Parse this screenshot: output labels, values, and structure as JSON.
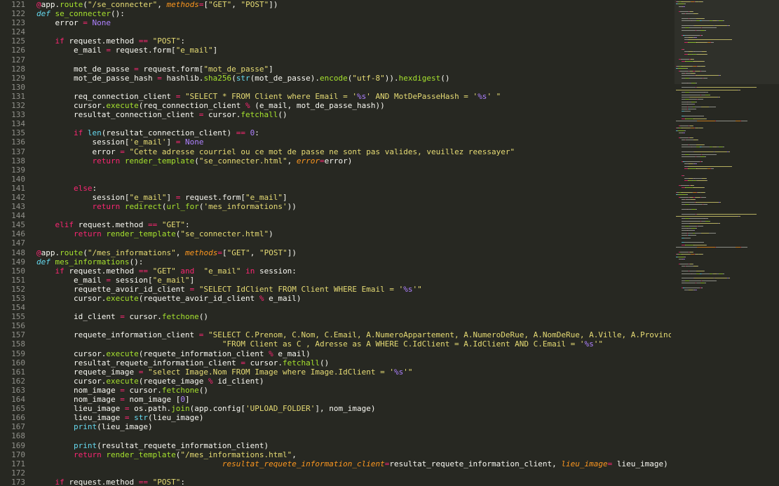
{
  "lines": [
    {
      "n": "121",
      "indent": 0,
      "tokens": [
        [
          "dec",
          "@"
        ],
        [
          "p",
          "app."
        ],
        [
          "fn",
          "route"
        ],
        [
          "p",
          "("
        ],
        [
          "str",
          "\"/se_connecter\""
        ],
        [
          "p",
          ", "
        ],
        [
          "param",
          "methods"
        ],
        [
          "op",
          "="
        ],
        [
          "p",
          "["
        ],
        [
          "str",
          "\"GET\""
        ],
        [
          "p",
          ", "
        ],
        [
          "str",
          "\"POST\""
        ],
        [
          "p",
          "])"
        ]
      ]
    },
    {
      "n": "122",
      "indent": 0,
      "tokens": [
        [
          "def",
          "def"
        ],
        [
          "p",
          " "
        ],
        [
          "fn",
          "se_connecter"
        ],
        [
          "p",
          "():"
        ]
      ]
    },
    {
      "n": "123",
      "indent": 1,
      "tokens": [
        [
          "p",
          "error "
        ],
        [
          "op",
          "="
        ],
        [
          "p",
          " "
        ],
        [
          "const",
          "None"
        ]
      ]
    },
    {
      "n": "124",
      "indent": 0,
      "tokens": []
    },
    {
      "n": "125",
      "indent": 1,
      "tokens": [
        [
          "kw",
          "if"
        ],
        [
          "p",
          " request.method "
        ],
        [
          "op",
          "=="
        ],
        [
          "p",
          " "
        ],
        [
          "str",
          "\"POST\""
        ],
        [
          "p",
          ":"
        ]
      ]
    },
    {
      "n": "126",
      "indent": 2,
      "tokens": [
        [
          "p",
          "e_mail "
        ],
        [
          "op",
          "="
        ],
        [
          "p",
          " request.form["
        ],
        [
          "str",
          "\"e_mail\""
        ],
        [
          "p",
          "]"
        ]
      ]
    },
    {
      "n": "127",
      "indent": 0,
      "tokens": []
    },
    {
      "n": "128",
      "indent": 2,
      "tokens": [
        [
          "p",
          "mot_de_passe "
        ],
        [
          "op",
          "="
        ],
        [
          "p",
          " request.form["
        ],
        [
          "str",
          "\"mot_de_passe\""
        ],
        [
          "p",
          "]"
        ]
      ]
    },
    {
      "n": "129",
      "indent": 2,
      "tokens": [
        [
          "p",
          "mot_de_passe_hash "
        ],
        [
          "op",
          "="
        ],
        [
          "p",
          " hashlib."
        ],
        [
          "fn",
          "sha256"
        ],
        [
          "p",
          "("
        ],
        [
          "bi",
          "str"
        ],
        [
          "p",
          "(mot_de_passe)."
        ],
        [
          "fn",
          "encode"
        ],
        [
          "p",
          "("
        ],
        [
          "str",
          "\"utf-8\""
        ],
        [
          "p",
          "))."
        ],
        [
          "fn",
          "hexdigest"
        ],
        [
          "p",
          "()"
        ]
      ]
    },
    {
      "n": "130",
      "indent": 0,
      "tokens": []
    },
    {
      "n": "131",
      "indent": 2,
      "tokens": [
        [
          "p",
          "req_connection_client "
        ],
        [
          "op",
          "="
        ],
        [
          "p",
          " "
        ],
        [
          "str",
          "\"SELECT * FROM Client where Email = '"
        ],
        [
          "num",
          "%s"
        ],
        [
          "str",
          "' AND MotDePasseHash = '"
        ],
        [
          "num",
          "%s"
        ],
        [
          "str",
          "' \""
        ]
      ]
    },
    {
      "n": "132",
      "indent": 2,
      "tokens": [
        [
          "p",
          "cursor."
        ],
        [
          "fn",
          "execute"
        ],
        [
          "p",
          "(req_connection_client "
        ],
        [
          "op",
          "%"
        ],
        [
          "p",
          " (e_mail, mot_de_passe_hash))"
        ]
      ]
    },
    {
      "n": "133",
      "indent": 2,
      "tokens": [
        [
          "p",
          "resultat_connection_client "
        ],
        [
          "op",
          "="
        ],
        [
          "p",
          " cursor."
        ],
        [
          "fn",
          "fetchall"
        ],
        [
          "p",
          "()"
        ]
      ]
    },
    {
      "n": "134",
      "indent": 0,
      "tokens": []
    },
    {
      "n": "135",
      "indent": 2,
      "tokens": [
        [
          "kw",
          "if"
        ],
        [
          "p",
          " "
        ],
        [
          "bi",
          "len"
        ],
        [
          "p",
          "(resultat_connection_client) "
        ],
        [
          "op",
          "=="
        ],
        [
          "p",
          " "
        ],
        [
          "num",
          "0"
        ],
        [
          "p",
          ":"
        ]
      ]
    },
    {
      "n": "136",
      "indent": 3,
      "tokens": [
        [
          "p",
          "session["
        ],
        [
          "str",
          "'e_mail'"
        ],
        [
          "p",
          "] "
        ],
        [
          "op",
          "="
        ],
        [
          "p",
          " "
        ],
        [
          "const",
          "None"
        ]
      ]
    },
    {
      "n": "137",
      "indent": 3,
      "tokens": [
        [
          "p",
          "error "
        ],
        [
          "op",
          "="
        ],
        [
          "p",
          " "
        ],
        [
          "str",
          "\"Cette adresse courriel ou ce mot de passe ne sont pas valides, veuillez reessayer\""
        ]
      ]
    },
    {
      "n": "138",
      "indent": 3,
      "tokens": [
        [
          "kw",
          "return"
        ],
        [
          "p",
          " "
        ],
        [
          "fn",
          "render_template"
        ],
        [
          "p",
          "("
        ],
        [
          "str",
          "\"se_connecter.html\""
        ],
        [
          "p",
          ", "
        ],
        [
          "param",
          "error"
        ],
        [
          "op",
          "="
        ],
        [
          "p",
          "error)"
        ]
      ]
    },
    {
      "n": "139",
      "indent": 0,
      "tokens": []
    },
    {
      "n": "140",
      "indent": 0,
      "tokens": []
    },
    {
      "n": "141",
      "indent": 2,
      "tokens": [
        [
          "kw",
          "else"
        ],
        [
          "p",
          ":"
        ]
      ]
    },
    {
      "n": "142",
      "indent": 3,
      "tokens": [
        [
          "p",
          "session["
        ],
        [
          "str",
          "\"e_mail\""
        ],
        [
          "p",
          "] "
        ],
        [
          "op",
          "="
        ],
        [
          "p",
          " request.form["
        ],
        [
          "str",
          "\"e_mail\""
        ],
        [
          "p",
          "]"
        ]
      ]
    },
    {
      "n": "143",
      "indent": 3,
      "tokens": [
        [
          "kw",
          "return"
        ],
        [
          "p",
          " "
        ],
        [
          "fn",
          "redirect"
        ],
        [
          "p",
          "("
        ],
        [
          "fn",
          "url_for"
        ],
        [
          "p",
          "("
        ],
        [
          "str",
          "'mes_informations'"
        ],
        [
          "p",
          "))"
        ]
      ]
    },
    {
      "n": "144",
      "indent": 0,
      "tokens": []
    },
    {
      "n": "145",
      "indent": 1,
      "tokens": [
        [
          "kw",
          "elif"
        ],
        [
          "p",
          " request.method "
        ],
        [
          "op",
          "=="
        ],
        [
          "p",
          " "
        ],
        [
          "str",
          "\"GET\""
        ],
        [
          "p",
          ":"
        ]
      ]
    },
    {
      "n": "146",
      "indent": 2,
      "tokens": [
        [
          "kw",
          "return"
        ],
        [
          "p",
          " "
        ],
        [
          "fn",
          "render_template"
        ],
        [
          "p",
          "("
        ],
        [
          "str",
          "\"se_connecter.html\""
        ],
        [
          "p",
          ")"
        ]
      ]
    },
    {
      "n": "147",
      "indent": 0,
      "tokens": []
    },
    {
      "n": "148",
      "indent": 0,
      "tokens": [
        [
          "dec",
          "@"
        ],
        [
          "p",
          "app."
        ],
        [
          "fn",
          "route"
        ],
        [
          "p",
          "("
        ],
        [
          "str",
          "\"/mes_informations\""
        ],
        [
          "p",
          ", "
        ],
        [
          "param",
          "methods"
        ],
        [
          "op",
          "="
        ],
        [
          "p",
          "["
        ],
        [
          "str",
          "\"GET\""
        ],
        [
          "p",
          ", "
        ],
        [
          "str",
          "\"POST\""
        ],
        [
          "p",
          "])"
        ]
      ]
    },
    {
      "n": "149",
      "indent": 0,
      "tokens": [
        [
          "def",
          "def"
        ],
        [
          "p",
          " "
        ],
        [
          "fn",
          "mes_informations"
        ],
        [
          "p",
          "():"
        ]
      ]
    },
    {
      "n": "150",
      "indent": 1,
      "tokens": [
        [
          "kw",
          "if"
        ],
        [
          "p",
          " request.method "
        ],
        [
          "op",
          "=="
        ],
        [
          "p",
          " "
        ],
        [
          "str",
          "\"GET\""
        ],
        [
          "p",
          " "
        ],
        [
          "kw",
          "and"
        ],
        [
          "p",
          "  "
        ],
        [
          "str",
          "\"e_mail\""
        ],
        [
          "p",
          " "
        ],
        [
          "kw",
          "in"
        ],
        [
          "p",
          " session:"
        ]
      ]
    },
    {
      "n": "151",
      "indent": 2,
      "tokens": [
        [
          "p",
          "e_mail "
        ],
        [
          "op",
          "="
        ],
        [
          "p",
          " session["
        ],
        [
          "str",
          "\"e_mail\""
        ],
        [
          "p",
          "]"
        ]
      ]
    },
    {
      "n": "152",
      "indent": 2,
      "tokens": [
        [
          "p",
          "requette_avoir_id_client "
        ],
        [
          "op",
          "="
        ],
        [
          "p",
          " "
        ],
        [
          "str",
          "\"SELECT IdClient FROM Client WHERE Email = '"
        ],
        [
          "num",
          "%s"
        ],
        [
          "str",
          "'\""
        ]
      ]
    },
    {
      "n": "153",
      "indent": 2,
      "tokens": [
        [
          "p",
          "cursor."
        ],
        [
          "fn",
          "execute"
        ],
        [
          "p",
          "(requette_avoir_id_client "
        ],
        [
          "op",
          "%"
        ],
        [
          "p",
          " e_mail)"
        ]
      ]
    },
    {
      "n": "154",
      "indent": 0,
      "tokens": []
    },
    {
      "n": "155",
      "indent": 2,
      "tokens": [
        [
          "p",
          "id_client "
        ],
        [
          "op",
          "="
        ],
        [
          "p",
          " cursor."
        ],
        [
          "fn",
          "fetchone"
        ],
        [
          "p",
          "()"
        ]
      ]
    },
    {
      "n": "156",
      "indent": 0,
      "tokens": []
    },
    {
      "n": "157",
      "indent": 2,
      "tokens": [
        [
          "p",
          "requete_information_client "
        ],
        [
          "op",
          "="
        ],
        [
          "p",
          " "
        ],
        [
          "str",
          "\"SELECT C.Prenom, C.Nom, C.Email, A.NumeroAppartement, A.NumeroDeRue, A.NomDeRue, A.Ville, A.Province, A.CodePosta"
        ]
      ]
    },
    {
      "n": "158",
      "indent": 0,
      "tokens": [
        [
          "str",
          "                                        \"FROM Client as C , Adresse as A WHERE C.IdClient = A.IdClient AND C.Email = '"
        ],
        [
          "num",
          "%s"
        ],
        [
          "str",
          "'\""
        ]
      ]
    },
    {
      "n": "159",
      "indent": 2,
      "tokens": [
        [
          "p",
          "cursor."
        ],
        [
          "fn",
          "execute"
        ],
        [
          "p",
          "(requete_information_client "
        ],
        [
          "op",
          "%"
        ],
        [
          "p",
          " e_mail)"
        ]
      ]
    },
    {
      "n": "160",
      "indent": 2,
      "tokens": [
        [
          "p",
          "resultat_requete_information_client "
        ],
        [
          "op",
          "="
        ],
        [
          "p",
          " cursor."
        ],
        [
          "fn",
          "fetchall"
        ],
        [
          "p",
          "()"
        ]
      ]
    },
    {
      "n": "161",
      "indent": 2,
      "tokens": [
        [
          "p",
          "requete_image "
        ],
        [
          "op",
          "="
        ],
        [
          "p",
          " "
        ],
        [
          "str",
          "\"select Image.Nom FROM Image where Image.IdClient = '"
        ],
        [
          "num",
          "%s"
        ],
        [
          "str",
          "'\""
        ]
      ]
    },
    {
      "n": "162",
      "indent": 2,
      "tokens": [
        [
          "p",
          "cursor."
        ],
        [
          "fn",
          "execute"
        ],
        [
          "p",
          "(requete_image "
        ],
        [
          "op",
          "%"
        ],
        [
          "p",
          " id_client)"
        ]
      ]
    },
    {
      "n": "163",
      "indent": 2,
      "tokens": [
        [
          "p",
          "nom_image "
        ],
        [
          "op",
          "="
        ],
        [
          "p",
          " cursor."
        ],
        [
          "fn",
          "fetchone"
        ],
        [
          "p",
          "()"
        ]
      ]
    },
    {
      "n": "164",
      "indent": 2,
      "tokens": [
        [
          "p",
          "nom_image "
        ],
        [
          "op",
          "="
        ],
        [
          "p",
          " nom_image ["
        ],
        [
          "num",
          "0"
        ],
        [
          "p",
          "]"
        ]
      ]
    },
    {
      "n": "165",
      "indent": 2,
      "tokens": [
        [
          "p",
          "lieu_image "
        ],
        [
          "op",
          "="
        ],
        [
          "p",
          " os.path."
        ],
        [
          "fn",
          "join"
        ],
        [
          "p",
          "(app.config["
        ],
        [
          "str",
          "'UPLOAD_FOLDER'"
        ],
        [
          "p",
          "], nom_image)"
        ]
      ]
    },
    {
      "n": "166",
      "indent": 2,
      "tokens": [
        [
          "p",
          "lieu_image "
        ],
        [
          "op",
          "="
        ],
        [
          "p",
          " "
        ],
        [
          "bi",
          "str"
        ],
        [
          "p",
          "(lieu_image)"
        ]
      ]
    },
    {
      "n": "167",
      "indent": 2,
      "tokens": [
        [
          "bi",
          "print"
        ],
        [
          "p",
          "(lieu_image)"
        ]
      ]
    },
    {
      "n": "168",
      "indent": 0,
      "tokens": []
    },
    {
      "n": "169",
      "indent": 2,
      "tokens": [
        [
          "bi",
          "print"
        ],
        [
          "p",
          "(resultat_requete_information_client)"
        ]
      ]
    },
    {
      "n": "170",
      "indent": 2,
      "tokens": [
        [
          "kw",
          "return"
        ],
        [
          "p",
          " "
        ],
        [
          "fn",
          "render_template"
        ],
        [
          "p",
          "("
        ],
        [
          "str",
          "\"/mes_informations.html\""
        ],
        [
          "p",
          ","
        ]
      ]
    },
    {
      "n": "171",
      "indent": 0,
      "tokens": [
        [
          "p",
          "                                        "
        ],
        [
          "param",
          "resultat_requete_information_client"
        ],
        [
          "op",
          "="
        ],
        [
          "p",
          "resultat_requete_information_client, "
        ],
        [
          "param",
          "lieu_image"
        ],
        [
          "op",
          "="
        ],
        [
          "p",
          " lieu_image)"
        ]
      ]
    },
    {
      "n": "172",
      "indent": 0,
      "tokens": []
    },
    {
      "n": "173",
      "indent": 1,
      "tokens": [
        [
          "kw",
          "if"
        ],
        [
          "p",
          " request.method "
        ],
        [
          "op",
          "=="
        ],
        [
          "p",
          " "
        ],
        [
          "str",
          "\"POST\""
        ],
        [
          "p",
          ":"
        ]
      ]
    }
  ],
  "colors": {
    "background": "#272822",
    "gutter_text": "#90908a",
    "keyword": "#f92672",
    "function": "#a6e22e",
    "string": "#e6db74",
    "number": "#ae81ff",
    "parameter": "#fd971f",
    "builtin": "#66d9ef"
  }
}
